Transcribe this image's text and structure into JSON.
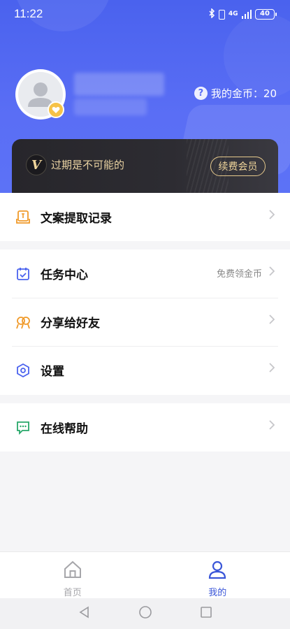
{
  "status_bar": {
    "time": "11:22",
    "network": "4G",
    "battery": "40"
  },
  "profile": {
    "coins_label": "我的金币：20",
    "help_icon": "question-circle-icon"
  },
  "vip": {
    "badge": "V",
    "text": "过期是不可能的",
    "renew_label": "续费会员"
  },
  "menu": {
    "records": {
      "label": "文案提取记录",
      "icon": "document-icon"
    },
    "tasks": {
      "label": "任务中心",
      "extra": "免费领金币",
      "icon": "calendar-check-icon"
    },
    "share": {
      "label": "分享给好友",
      "icon": "share-people-icon"
    },
    "settings": {
      "label": "设置",
      "icon": "hexagon-gear-icon"
    },
    "help": {
      "label": "在线帮助",
      "icon": "chat-bubble-icon"
    }
  },
  "bottom_nav": {
    "home": {
      "label": "首页",
      "icon": "home-icon"
    },
    "me": {
      "label": "我的",
      "icon": "user-icon",
      "active": true
    }
  },
  "colors": {
    "primary": "#4a62ee",
    "gold": "#f0d59b",
    "vip_bg": "#2b2a30",
    "active_nav": "#3a56d8",
    "orange": "#f09a2a",
    "green": "#27a86a"
  }
}
